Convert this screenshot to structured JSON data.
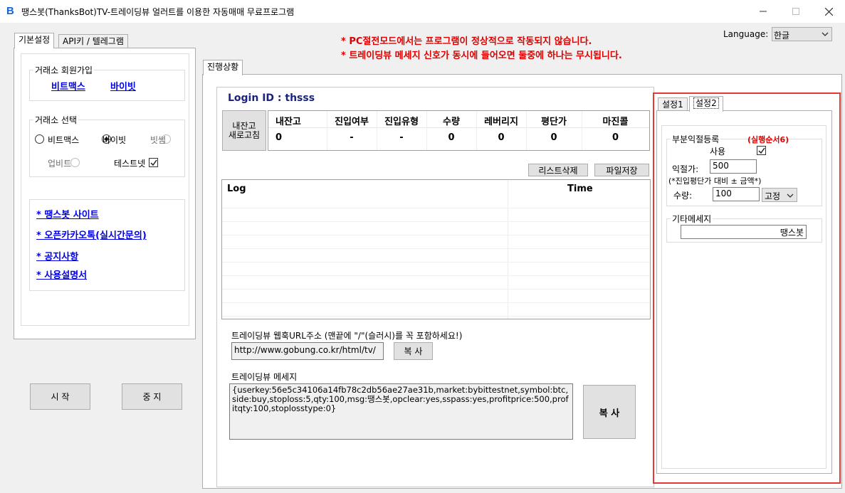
{
  "window": {
    "logo": "B",
    "title": "땡스봇(ThanksBot)TV-트레이딩뷰 얼러트를 이용한 자동매매 무료프로그램"
  },
  "left": {
    "tabs": [
      "기본설정",
      "API키 / 텔레그램"
    ],
    "signup": {
      "label": "거래소 회원가입",
      "links": [
        "비트맥스",
        "바이빗"
      ]
    },
    "exchange": {
      "label": "거래소 선택",
      "options": [
        "비트맥스",
        "바이빗",
        "빗썸",
        "업비트"
      ],
      "testnet": "테스트넷"
    },
    "links": [
      "* 땡스봇 사이트",
      "* 오픈카카오톡(실시간문의)",
      "* 공지사항",
      "* 사용설명서"
    ],
    "start": "시 작",
    "stop": "중 지"
  },
  "notices": [
    "* PC절전모드에서는 프로그램이 정상적으로 작동되지 않습니다.",
    "* 트레이딩뷰 메세지 신호가 동시에 들어오면 둘중에 하나는 무시됩니다."
  ],
  "language": {
    "label": "Language:",
    "value": "한글"
  },
  "main": {
    "tab": "진행상황",
    "login": "Login ID : thsss",
    "refresh": "내잔고\n새로고침",
    "status": {
      "headers": [
        "내잔고",
        "진입여부",
        "진입유형",
        "수량",
        "레버리지",
        "평단가",
        "마진콜"
      ],
      "values": [
        "0",
        "-",
        "-",
        "0",
        "0",
        "0",
        "0"
      ]
    },
    "delete_list": "리스트삭제",
    "save_file": "파일저장",
    "log": {
      "col_log": "Log",
      "col_time": "Time"
    },
    "webhook_label": "트레이딩뷰 웹훅URL주소 (맨끝에 \"/\"(슬러시)를 꼭 포함하세요!)",
    "webhook_url": "http://www.gobung.co.kr/html/tv/",
    "copy_small": "복 사",
    "message_label": "트레이딩뷰 메세지",
    "message": "{userkey:56e5c34106a14fb78c2db56ae27ae31b,market:bybittestnet,symbol:btc,side:buy,stoploss:5,qty:100,msg:땡스봇,opclear:yes,sspass:yes,profitprice:500,profitqty:100,stoplosstype:0}",
    "copy_big": "복 사"
  },
  "settings": {
    "tabs": [
      "설정1",
      "설정2"
    ],
    "partial": {
      "label": "부분익절등록",
      "order_note": "(실행순서6)",
      "use": "사용",
      "price_label": "익절가:",
      "price": "500",
      "hint": "(*진입평단가 대비 ± 금액*)",
      "qty_label": "수량:",
      "qty": "100",
      "qty_type": "고정"
    },
    "etc": {
      "label": "기타메세지",
      "value": "땡스봇"
    }
  },
  "colors": {
    "highlight": "#e53935",
    "notice": "#e00000",
    "link": "#0000ee",
    "logo": "#1565d8"
  }
}
